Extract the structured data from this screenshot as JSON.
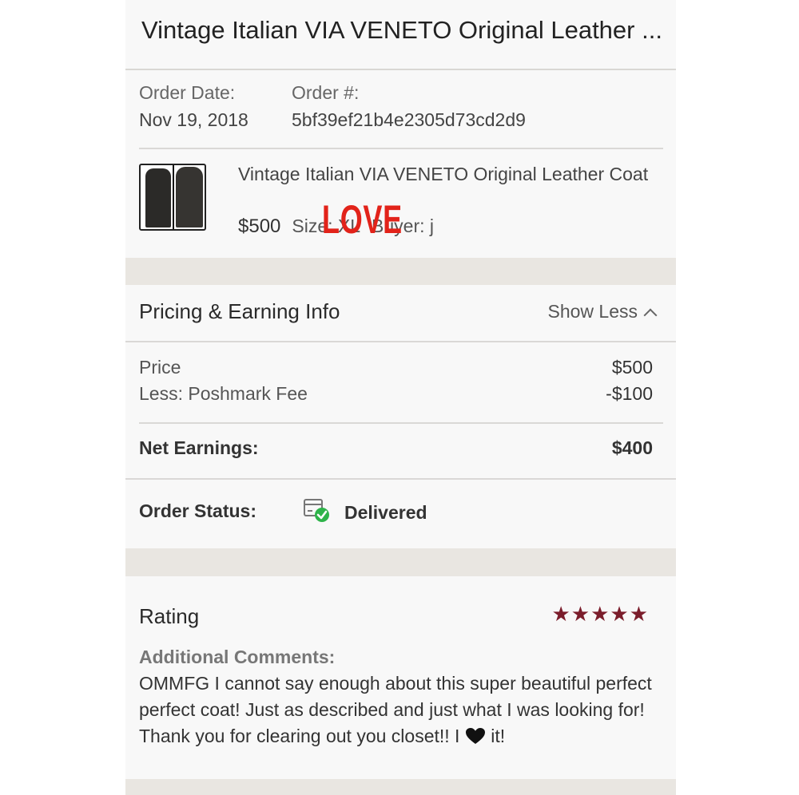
{
  "header": {
    "title": "Vintage Italian VIA VENETO Original Leather ..."
  },
  "order": {
    "date_label": "Order Date:",
    "date_value": "Nov 19, 2018",
    "number_label": "Order #:",
    "number_value": "5bf39ef21b4e2305d73cd2d9"
  },
  "item": {
    "title": "Vintage Italian VIA VENETO Original Leather Coat",
    "price": "$500",
    "size": "Size: XL",
    "buyer": "Buyer: j",
    "overlay_text": "LOVE"
  },
  "pricing": {
    "title": "Pricing & Earning Info",
    "toggle_label": "Show Less",
    "price_label": "Price",
    "price_value": "$500",
    "fee_label": "Less: Poshmark Fee",
    "fee_value": "-$100",
    "net_label": "Net Earnings:",
    "net_value": "$400",
    "status_label": "Order Status:",
    "status_value": "Delivered"
  },
  "rating": {
    "title": "Rating",
    "stars": "★★★★★",
    "star_count": 5,
    "comments_label": "Additional Comments:",
    "comment_text": "OMMFG I cannot say enough about this super beautiful perfect perfect coat! Just as described and just what I was looking for! Thank you for clearing out you closet!! I",
    "comment_end": " it!"
  },
  "colors": {
    "star": "#7b1d2b",
    "love": "#e2231a",
    "check": "#2eb34a"
  }
}
